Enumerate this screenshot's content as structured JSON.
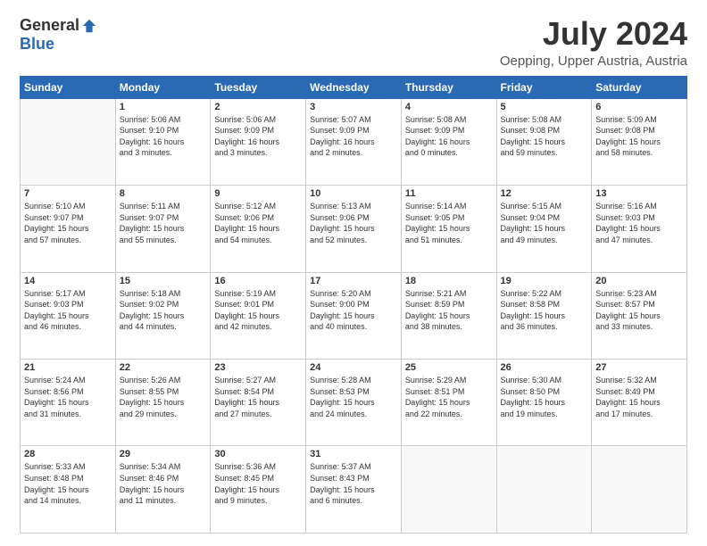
{
  "logo": {
    "general": "General",
    "blue": "Blue"
  },
  "title": "July 2024",
  "subtitle": "Oepping, Upper Austria, Austria",
  "days_of_week": [
    "Sunday",
    "Monday",
    "Tuesday",
    "Wednesday",
    "Thursday",
    "Friday",
    "Saturday"
  ],
  "weeks": [
    [
      {
        "day": "",
        "info": ""
      },
      {
        "day": "1",
        "info": "Sunrise: 5:06 AM\nSunset: 9:10 PM\nDaylight: 16 hours\nand 3 minutes."
      },
      {
        "day": "2",
        "info": "Sunrise: 5:06 AM\nSunset: 9:09 PM\nDaylight: 16 hours\nand 3 minutes."
      },
      {
        "day": "3",
        "info": "Sunrise: 5:07 AM\nSunset: 9:09 PM\nDaylight: 16 hours\nand 2 minutes."
      },
      {
        "day": "4",
        "info": "Sunrise: 5:08 AM\nSunset: 9:09 PM\nDaylight: 16 hours\nand 0 minutes."
      },
      {
        "day": "5",
        "info": "Sunrise: 5:08 AM\nSunset: 9:08 PM\nDaylight: 15 hours\nand 59 minutes."
      },
      {
        "day": "6",
        "info": "Sunrise: 5:09 AM\nSunset: 9:08 PM\nDaylight: 15 hours\nand 58 minutes."
      }
    ],
    [
      {
        "day": "7",
        "info": "Sunrise: 5:10 AM\nSunset: 9:07 PM\nDaylight: 15 hours\nand 57 minutes."
      },
      {
        "day": "8",
        "info": "Sunrise: 5:11 AM\nSunset: 9:07 PM\nDaylight: 15 hours\nand 55 minutes."
      },
      {
        "day": "9",
        "info": "Sunrise: 5:12 AM\nSunset: 9:06 PM\nDaylight: 15 hours\nand 54 minutes."
      },
      {
        "day": "10",
        "info": "Sunrise: 5:13 AM\nSunset: 9:06 PM\nDaylight: 15 hours\nand 52 minutes."
      },
      {
        "day": "11",
        "info": "Sunrise: 5:14 AM\nSunset: 9:05 PM\nDaylight: 15 hours\nand 51 minutes."
      },
      {
        "day": "12",
        "info": "Sunrise: 5:15 AM\nSunset: 9:04 PM\nDaylight: 15 hours\nand 49 minutes."
      },
      {
        "day": "13",
        "info": "Sunrise: 5:16 AM\nSunset: 9:03 PM\nDaylight: 15 hours\nand 47 minutes."
      }
    ],
    [
      {
        "day": "14",
        "info": "Sunrise: 5:17 AM\nSunset: 9:03 PM\nDaylight: 15 hours\nand 46 minutes."
      },
      {
        "day": "15",
        "info": "Sunrise: 5:18 AM\nSunset: 9:02 PM\nDaylight: 15 hours\nand 44 minutes."
      },
      {
        "day": "16",
        "info": "Sunrise: 5:19 AM\nSunset: 9:01 PM\nDaylight: 15 hours\nand 42 minutes."
      },
      {
        "day": "17",
        "info": "Sunrise: 5:20 AM\nSunset: 9:00 PM\nDaylight: 15 hours\nand 40 minutes."
      },
      {
        "day": "18",
        "info": "Sunrise: 5:21 AM\nSunset: 8:59 PM\nDaylight: 15 hours\nand 38 minutes."
      },
      {
        "day": "19",
        "info": "Sunrise: 5:22 AM\nSunset: 8:58 PM\nDaylight: 15 hours\nand 36 minutes."
      },
      {
        "day": "20",
        "info": "Sunrise: 5:23 AM\nSunset: 8:57 PM\nDaylight: 15 hours\nand 33 minutes."
      }
    ],
    [
      {
        "day": "21",
        "info": "Sunrise: 5:24 AM\nSunset: 8:56 PM\nDaylight: 15 hours\nand 31 minutes."
      },
      {
        "day": "22",
        "info": "Sunrise: 5:26 AM\nSunset: 8:55 PM\nDaylight: 15 hours\nand 29 minutes."
      },
      {
        "day": "23",
        "info": "Sunrise: 5:27 AM\nSunset: 8:54 PM\nDaylight: 15 hours\nand 27 minutes."
      },
      {
        "day": "24",
        "info": "Sunrise: 5:28 AM\nSunset: 8:53 PM\nDaylight: 15 hours\nand 24 minutes."
      },
      {
        "day": "25",
        "info": "Sunrise: 5:29 AM\nSunset: 8:51 PM\nDaylight: 15 hours\nand 22 minutes."
      },
      {
        "day": "26",
        "info": "Sunrise: 5:30 AM\nSunset: 8:50 PM\nDaylight: 15 hours\nand 19 minutes."
      },
      {
        "day": "27",
        "info": "Sunrise: 5:32 AM\nSunset: 8:49 PM\nDaylight: 15 hours\nand 17 minutes."
      }
    ],
    [
      {
        "day": "28",
        "info": "Sunrise: 5:33 AM\nSunset: 8:48 PM\nDaylight: 15 hours\nand 14 minutes."
      },
      {
        "day": "29",
        "info": "Sunrise: 5:34 AM\nSunset: 8:46 PM\nDaylight: 15 hours\nand 11 minutes."
      },
      {
        "day": "30",
        "info": "Sunrise: 5:36 AM\nSunset: 8:45 PM\nDaylight: 15 hours\nand 9 minutes."
      },
      {
        "day": "31",
        "info": "Sunrise: 5:37 AM\nSunset: 8:43 PM\nDaylight: 15 hours\nand 6 minutes."
      },
      {
        "day": "",
        "info": ""
      },
      {
        "day": "",
        "info": ""
      },
      {
        "day": "",
        "info": ""
      }
    ]
  ]
}
